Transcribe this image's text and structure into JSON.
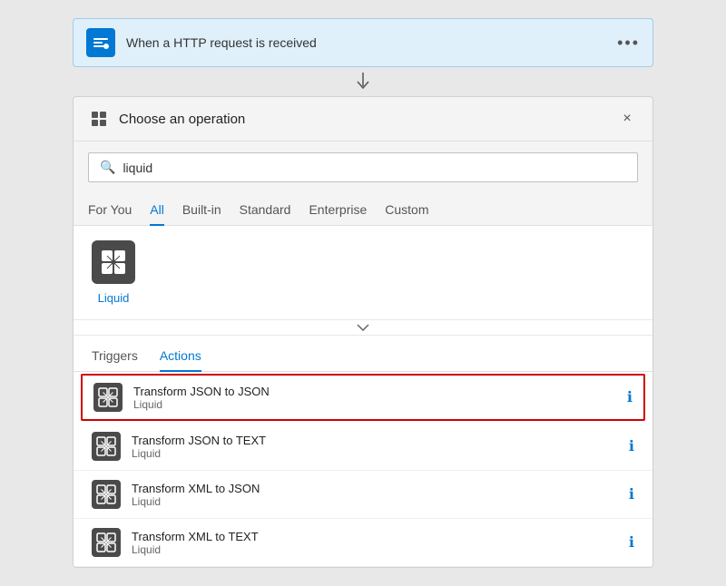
{
  "trigger": {
    "label": "When a HTTP request is received",
    "more_icon": "•••"
  },
  "panel": {
    "title": "Choose an operation",
    "close_label": "×"
  },
  "search": {
    "placeholder": "liquid",
    "value": "liquid"
  },
  "tabs": [
    {
      "id": "for-you",
      "label": "For You",
      "active": false
    },
    {
      "id": "all",
      "label": "All",
      "active": true
    },
    {
      "id": "built-in",
      "label": "Built-in",
      "active": false
    },
    {
      "id": "standard",
      "label": "Standard",
      "active": false
    },
    {
      "id": "enterprise",
      "label": "Enterprise",
      "active": false
    },
    {
      "id": "custom",
      "label": "Custom",
      "active": false
    }
  ],
  "liquid": {
    "label": "Liquid"
  },
  "sub_tabs": [
    {
      "id": "triggers",
      "label": "Triggers",
      "active": false
    },
    {
      "id": "actions",
      "label": "Actions",
      "active": true
    }
  ],
  "actions": [
    {
      "id": "action-1",
      "title": "Transform JSON to JSON",
      "subtitle": "Liquid",
      "selected": true
    },
    {
      "id": "action-2",
      "title": "Transform JSON to TEXT",
      "subtitle": "Liquid",
      "selected": false
    },
    {
      "id": "action-3",
      "title": "Transform XML to JSON",
      "subtitle": "Liquid",
      "selected": false
    },
    {
      "id": "action-4",
      "title": "Transform XML to TEXT",
      "subtitle": "Liquid",
      "selected": false
    }
  ]
}
